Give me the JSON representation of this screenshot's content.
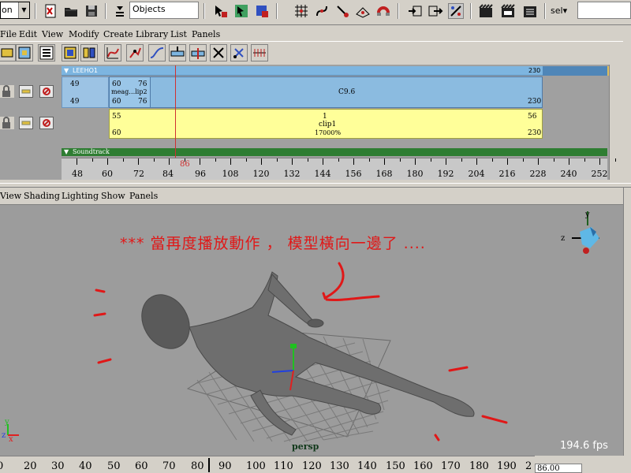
{
  "shelf": {
    "mode_value": "on",
    "selection_mask": "Objects",
    "sel_label": "sel",
    "name_field_value": ""
  },
  "trax": {
    "menus": [
      "File",
      "Edit",
      "View",
      "Modify",
      "Create",
      "Library",
      "List",
      "Panels"
    ],
    "character": "LEEHO1",
    "character_end": "230",
    "track1": {
      "left_top": "49",
      "left_bottom": "49",
      "clip_start_top": "60",
      "clip_start_bot": "60",
      "clip_sub_top": "76",
      "clip_sub_bot": "76",
      "clip_sub_name": "meag…lip2",
      "clip_name": "C9.6",
      "clip_end": "230"
    },
    "track2": {
      "left": "55",
      "right": "56",
      "count": "1",
      "name": "clip1",
      "scale": "17000%",
      "start": "60",
      "end": "230"
    },
    "soundtrack": "Soundtrack",
    "ruler_labels": [
      "48",
      "60",
      "72",
      "84",
      "96",
      "108",
      "120",
      "132",
      "144",
      "156",
      "168",
      "180",
      "192",
      "204",
      "216",
      "228",
      "240",
      "252"
    ],
    "current_time": "86"
  },
  "viewport": {
    "menus": [
      "View",
      "Shading",
      "Lighting",
      "Show",
      "Panels"
    ],
    "caption": "*** 當再度播放動作 ， 模型橫向一邊了 ....",
    "camera": "persp",
    "fps": "194.6 fps",
    "axis_labels": {
      "x": "x",
      "y": "y",
      "z": "z"
    }
  },
  "timeline": {
    "labels": [
      "20",
      "30",
      "40",
      "50",
      "60",
      "70",
      "80",
      "90",
      "100",
      "110",
      "120",
      "130",
      "140",
      "150",
      "160",
      "170",
      "180",
      "190",
      "2"
    ],
    "first_label": "0",
    "current_frame": "86.00"
  },
  "colors": {
    "trax_character_bar": "#7db5e0",
    "clip_blue": "#8bbbe0",
    "clip_yellow": "#ffff99",
    "soundtrack_green": "#2e7d32",
    "annotation_red": "#e01818",
    "viewport_bg": "#9c9c9c"
  }
}
